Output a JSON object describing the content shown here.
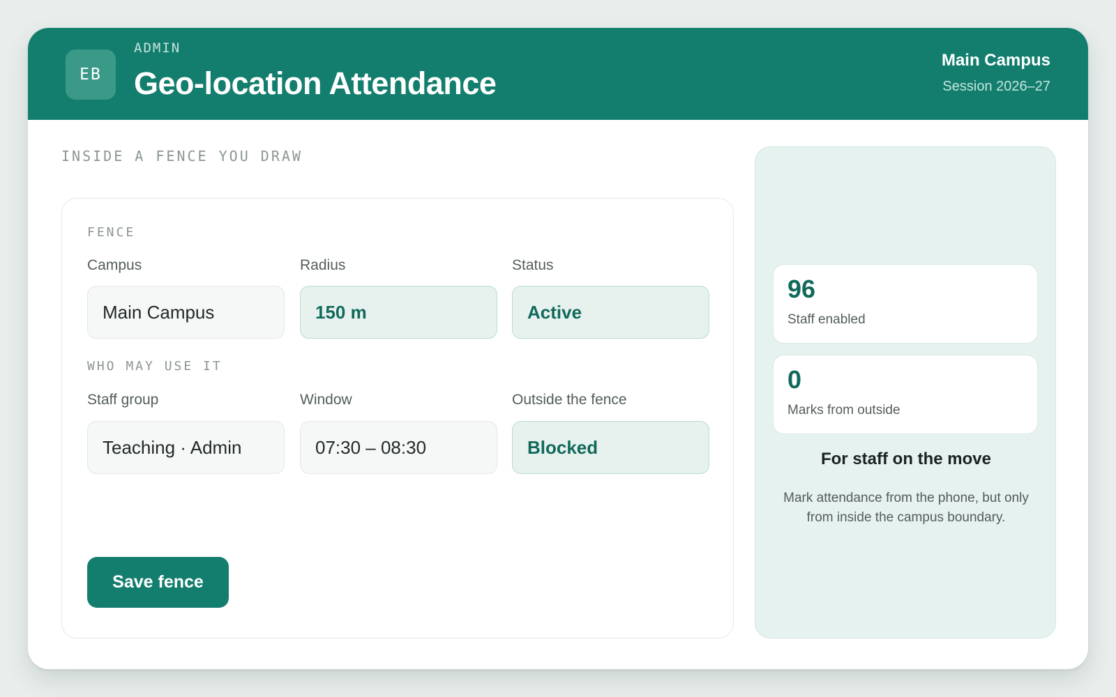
{
  "header": {
    "avatar_initials": "EB",
    "eyebrow": "ADMIN",
    "title": "Geo-location Attendance",
    "campus": "Main Campus",
    "session": "Session 2026–27"
  },
  "main": {
    "section_caption": "INSIDE A FENCE YOU DRAW",
    "fence_group": {
      "label": "FENCE",
      "fields": [
        {
          "label": "Campus",
          "value": "Main Campus",
          "style": "plain"
        },
        {
          "label": "Radius",
          "value": "150 m",
          "style": "accent"
        },
        {
          "label": "Status",
          "value": "Active",
          "style": "accent"
        }
      ]
    },
    "usage_group": {
      "label": "WHO MAY USE IT",
      "fields": [
        {
          "label": "Staff group",
          "value": "Teaching · Admin",
          "style": "plain"
        },
        {
          "label": "Window",
          "value": "07:30 – 08:30",
          "style": "plain"
        },
        {
          "label": "Outside the fence",
          "value": "Blocked",
          "style": "accent"
        }
      ]
    },
    "save_label": "Save fence"
  },
  "sidebar": {
    "stats": [
      {
        "value": "96",
        "label": "Staff enabled"
      },
      {
        "value": "0",
        "label": "Marks from outside"
      }
    ],
    "title": "For staff on the move",
    "description": "Mark attendance from the phone, but only from inside the campus boundary."
  },
  "colors": {
    "brand": "#137e6e",
    "accent_text": "#11695b",
    "accent_fill": "#e7f2ef",
    "page_background": "#e9eeed"
  }
}
